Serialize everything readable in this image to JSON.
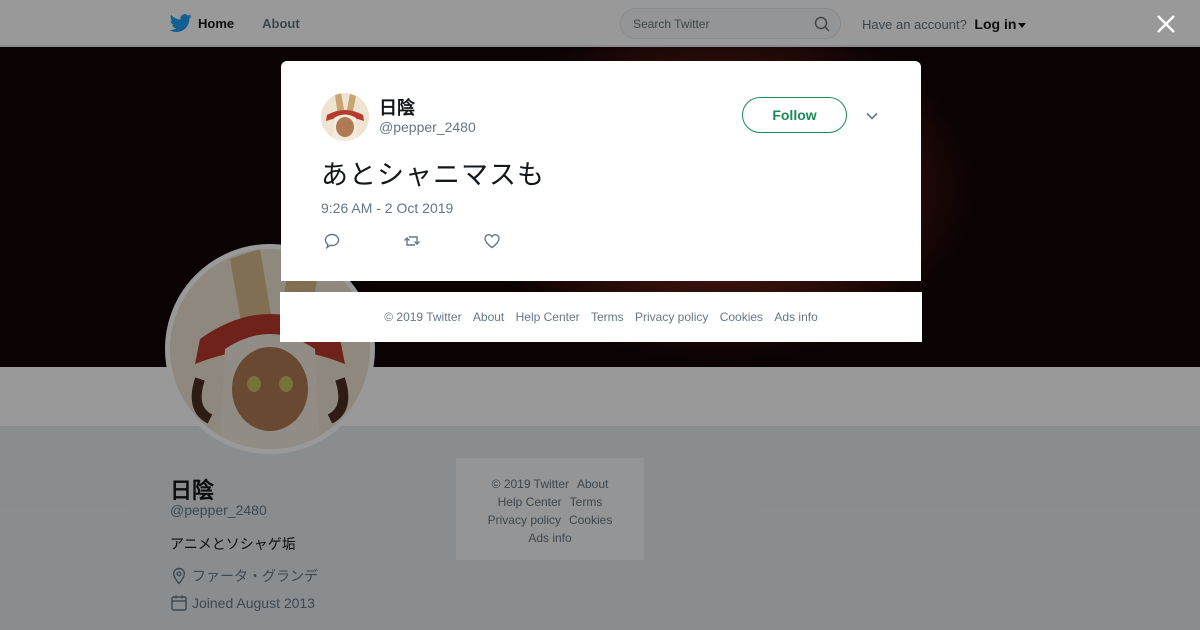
{
  "colors": {
    "brand": "#1da1f2",
    "follow": "#1b8a5a",
    "muted": "#657786"
  },
  "nav": {
    "home": "Home",
    "about": "About"
  },
  "search": {
    "placeholder": "Search Twitter"
  },
  "account": {
    "prompt": "Have an account?",
    "login": "Log in"
  },
  "profile": {
    "name": "日陰",
    "handle": "@pepper_2480",
    "bio": "アニメとソシャゲ垢",
    "location": "ファータ・グランデ",
    "joined": "Joined August 2013"
  },
  "side_footer": [
    "© 2019 Twitter",
    "About",
    "Help Center",
    "Terms",
    "Privacy policy",
    "Cookies",
    "Ads info"
  ],
  "tweet": {
    "name": "日陰",
    "handle": "@pepper_2480",
    "follow_label": "Follow",
    "text": "あとシャニマスも",
    "timestamp": "9:26 AM - 2 Oct 2019"
  },
  "modal_footer": [
    "© 2019 Twitter",
    "About",
    "Help Center",
    "Terms",
    "Privacy policy",
    "Cookies",
    "Ads info"
  ]
}
